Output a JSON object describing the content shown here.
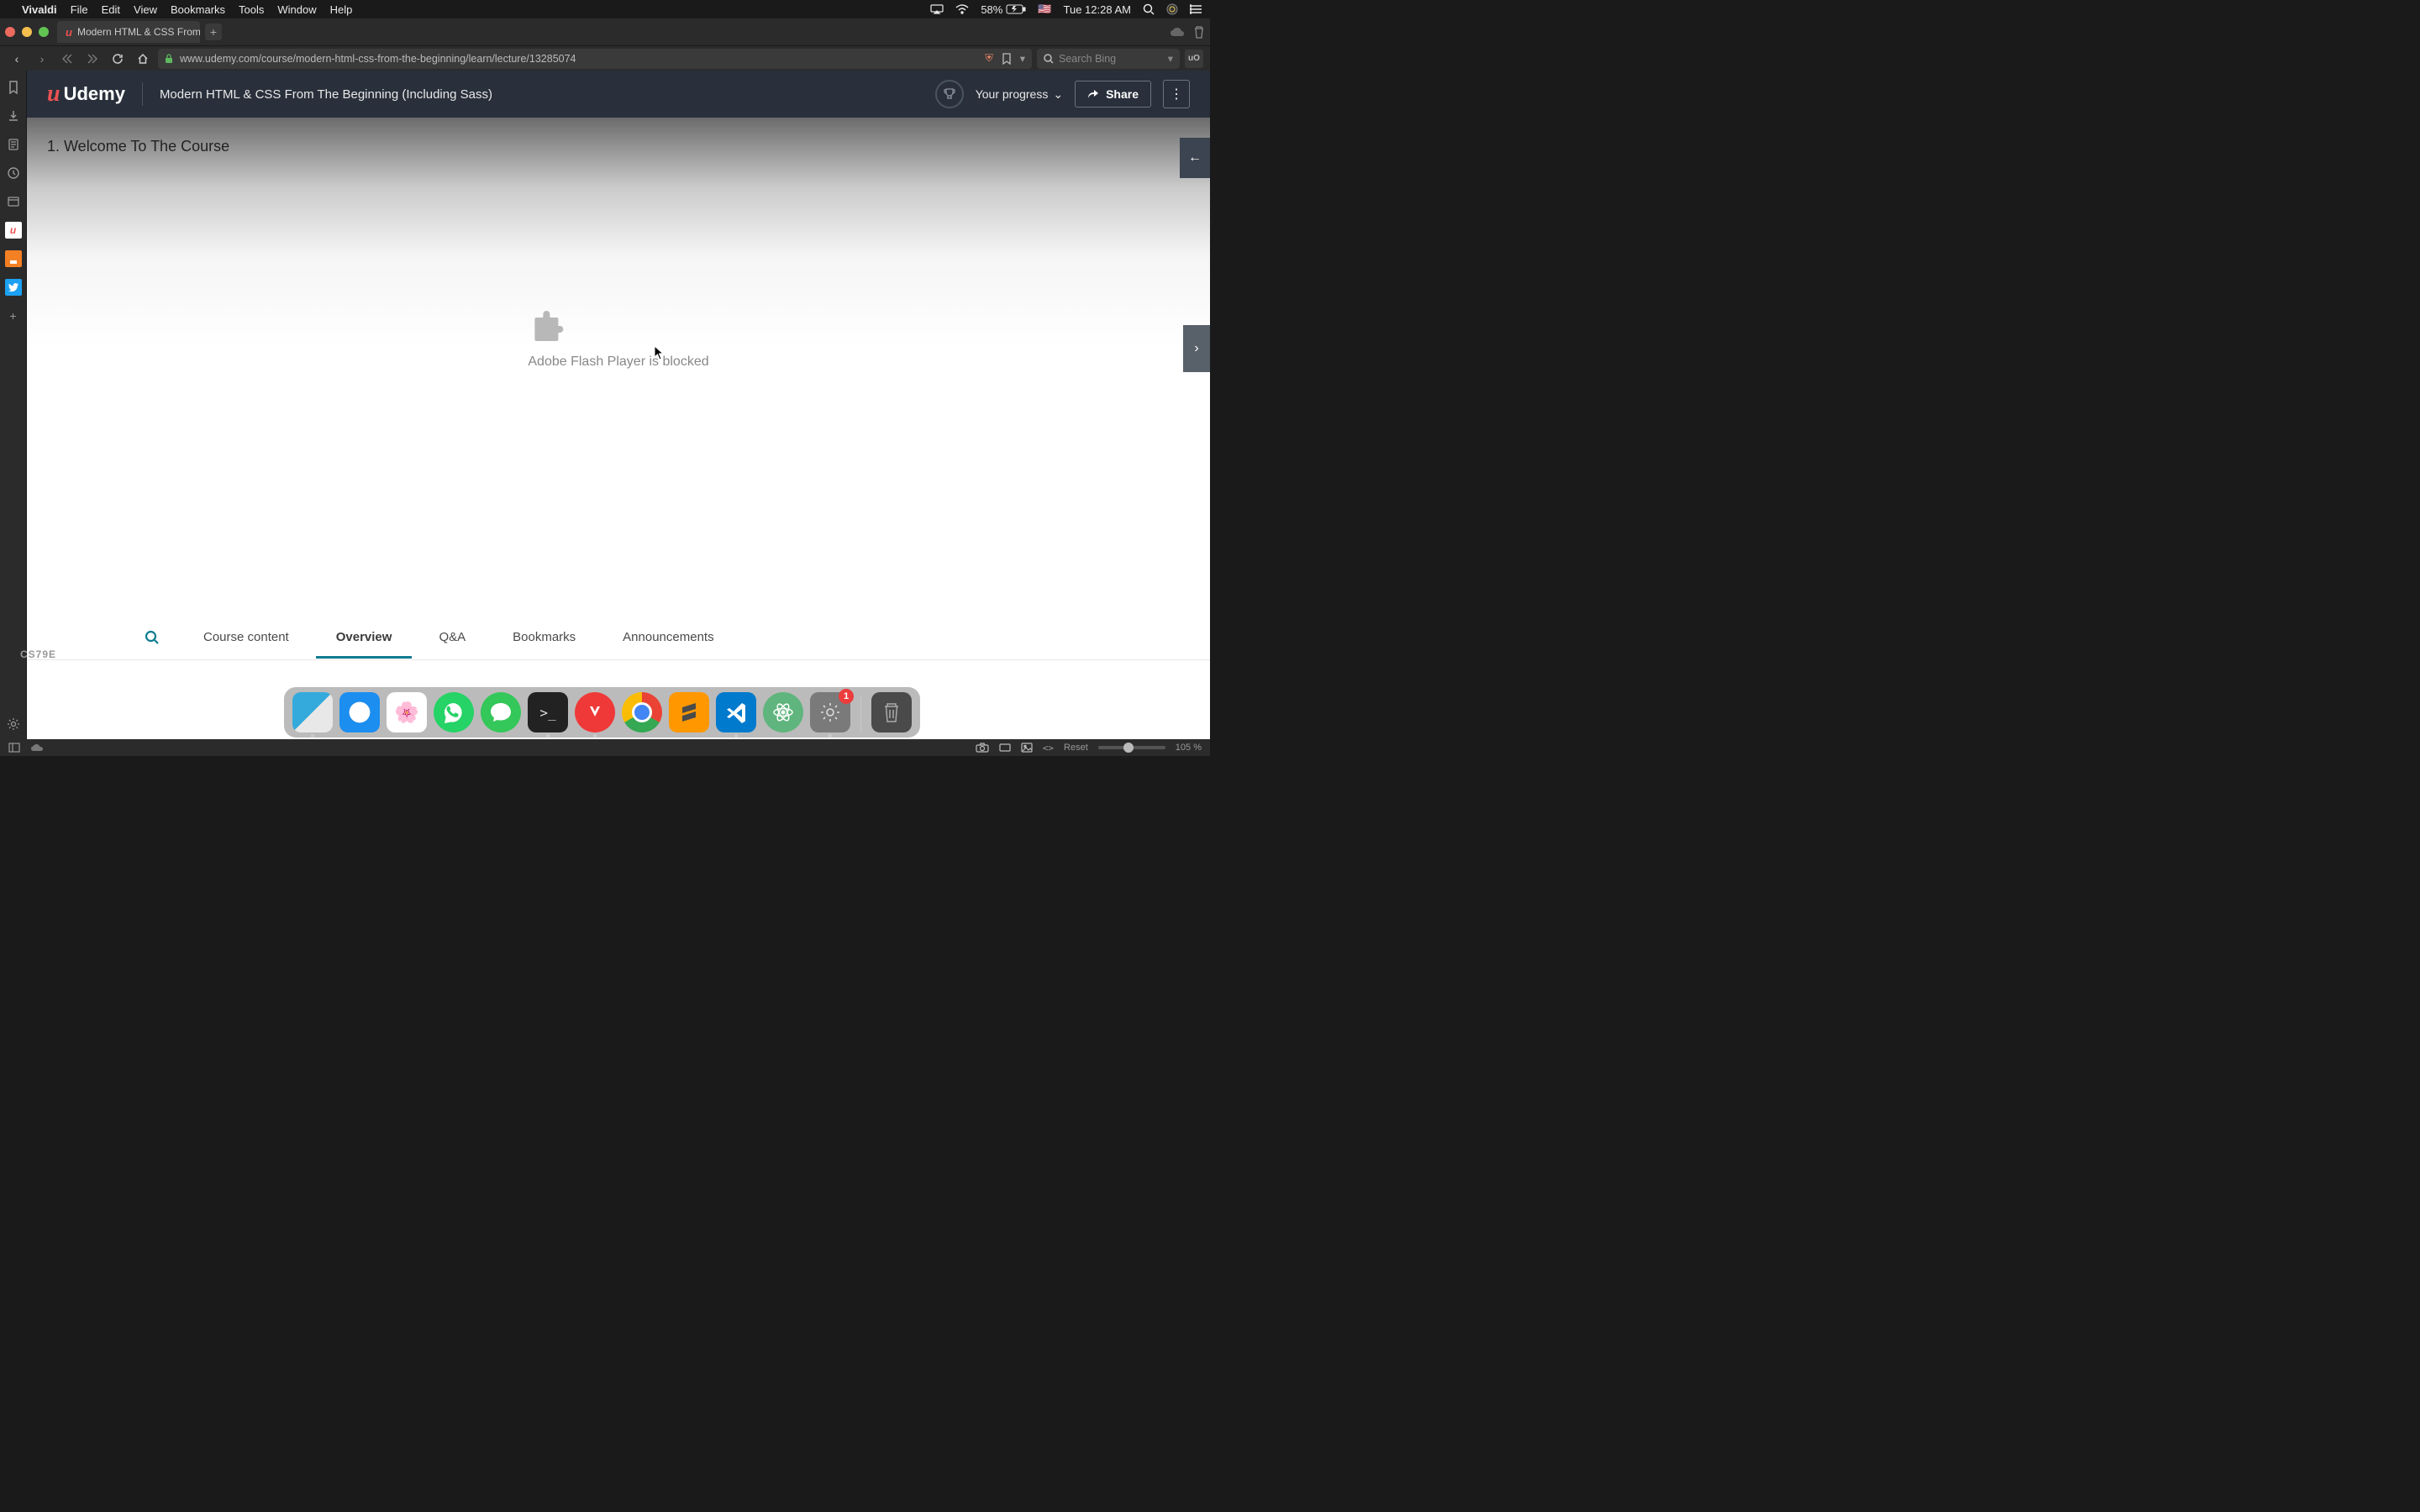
{
  "macos": {
    "app_name": "Vivaldi",
    "menus": [
      "File",
      "Edit",
      "View",
      "Bookmarks",
      "Tools",
      "Window",
      "Help"
    ],
    "battery": "58%",
    "clock": "Tue 12:28 AM"
  },
  "browser": {
    "tab_title": "Modern HTML & CSS From T",
    "url": "www.udemy.com/course/modern-html-css-from-the-beginning/learn/lecture/13285074",
    "search_placeholder": "Search Bing"
  },
  "udemy": {
    "logo_text": "Udemy",
    "course_title": "Modern HTML & CSS From The Beginning (Including Sass)",
    "progress_label": "Your progress",
    "share_label": "Share",
    "lesson_title": "1. Welcome To The Course",
    "flash_message": "Adobe Flash Player is blocked",
    "tabs": {
      "content": "Course content",
      "overview": "Overview",
      "qna": "Q&A",
      "bookmarks": "Bookmarks",
      "announcements": "Announcements"
    }
  },
  "status": {
    "reset": "Reset",
    "zoom": "105 %"
  },
  "dock": {
    "left_label": "CS79E",
    "badge": "1"
  }
}
